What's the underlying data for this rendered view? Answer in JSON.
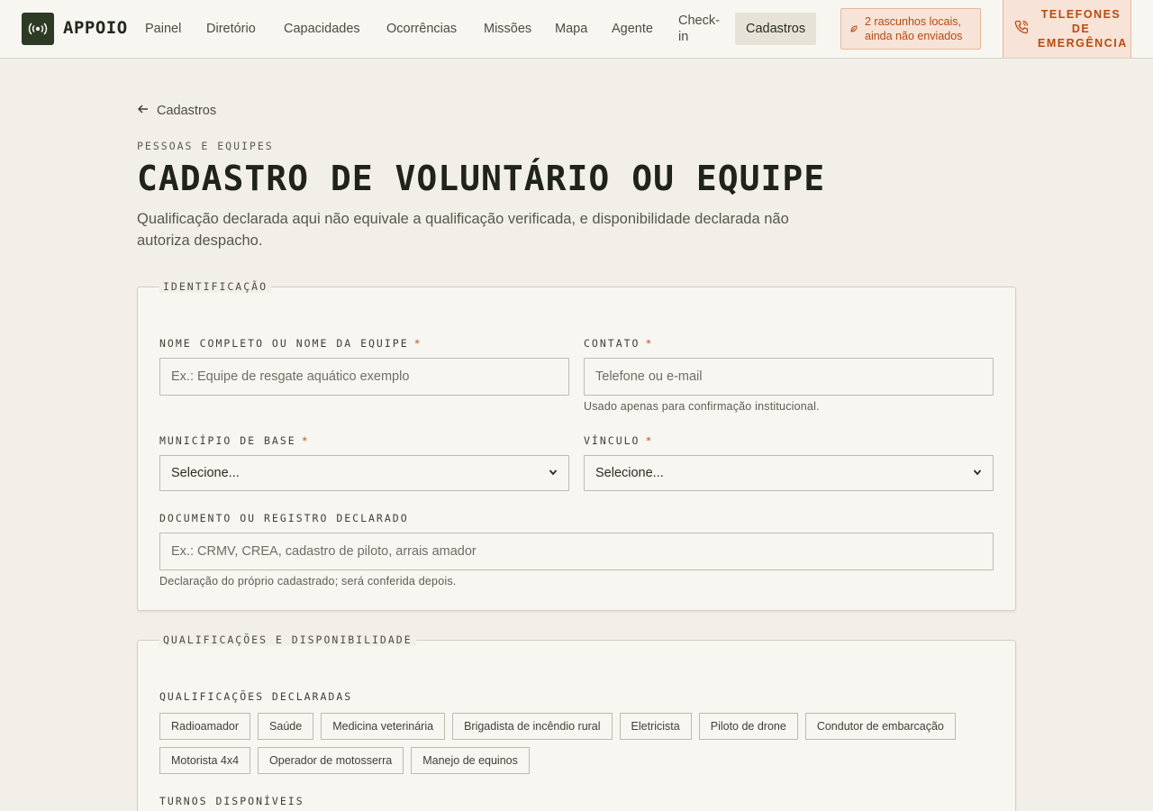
{
  "header": {
    "brand": "APPOIO",
    "nav": [
      "Painel",
      "Diretório",
      "Capacidades",
      "Ocorrências",
      "Missões",
      "Mapa",
      "Agente",
      "Check-in",
      "Cadastros"
    ],
    "drafts_label": "2 rascunhos locais, ainda não enviados",
    "emergency_label": "TELEFONES DE EMERGÊNCIA"
  },
  "page": {
    "back_label": "Cadastros",
    "eyebrow": "PESSOAS E EQUIPES",
    "title": "CADASTRO DE VOLUNTÁRIO OU EQUIPE",
    "subtitle": "Qualificação declarada aqui não equivale a qualificação verificada, e disponibilidade declarada não autoriza despacho."
  },
  "identification": {
    "legend": "IDENTIFICAÇÃO",
    "name_label": "NOME COMPLETO OU NOME DA EQUIPE",
    "name_placeholder": "Ex.: Equipe de resgate aquático exemplo",
    "contact_label": "CONTATO",
    "contact_placeholder": "Telefone ou e-mail",
    "contact_help": "Usado apenas para confirmação institucional.",
    "municipality_label": "MUNICÍPIO DE BASE",
    "municipality_value": "Selecione...",
    "link_label": "VÍNCULO",
    "link_value": "Selecione...",
    "document_label": "DOCUMENTO OU REGISTRO DECLARADO",
    "document_placeholder": "Ex.: CRMV, CREA, cadastro de piloto, arrais amador",
    "document_help": "Declaração do próprio cadastrado; será conferida depois.",
    "required_mark": "*"
  },
  "qualifications": {
    "legend": "QUALIFICAÇÕES E DISPONIBILIDADE",
    "declared_label": "QUALIFICAÇÕES DECLARADAS",
    "chips": [
      "Radioamador",
      "Saúde",
      "Medicina veterinária",
      "Brigadista de incêndio rural",
      "Eletricista",
      "Piloto de drone",
      "Condutor de embarcação",
      "Motorista 4x4",
      "Operador de motosserra",
      "Manejo de equinos"
    ],
    "shifts_label": "TURNOS DISPONÍVEIS"
  },
  "colors": {
    "accent": "#b94a10",
    "brand_dark": "#2d3a24",
    "background": "#f2efe8"
  }
}
